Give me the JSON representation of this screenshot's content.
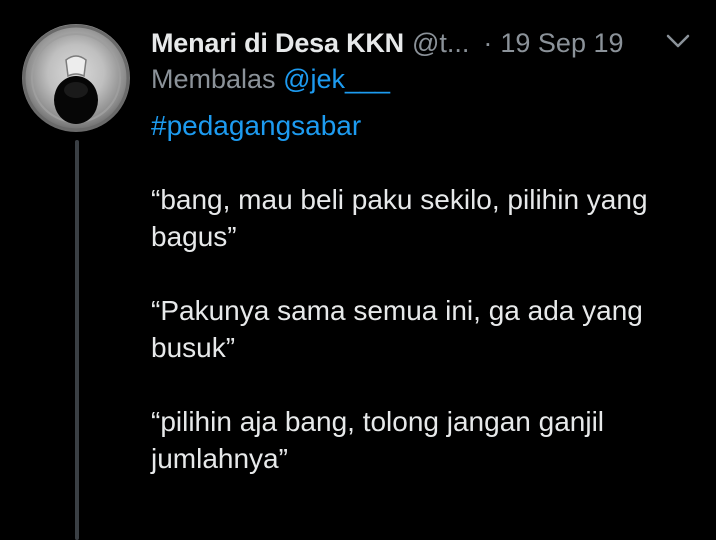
{
  "tweet": {
    "author_name": "Menari di Desa KKN",
    "handle": "@t...",
    "separator": "·",
    "date": "19 Sep 19",
    "reply_prefix": "Membalas",
    "reply_to": "@jek___",
    "hashtag": "#pedagangsabar",
    "paragraphs": [
      "“bang, mau beli paku sekilo, pilihin yang bagus”",
      "“Pakunya sama semua ini, ga ada yang busuk”",
      "“pilihin aja bang, tolong jangan ganjil jumlahnya”"
    ],
    "menu_icon": "chevron-down-icon",
    "colors": {
      "background": "#000000",
      "primary_text": "#e7e9ea",
      "secondary_text": "#8b9299",
      "link": "#1d9bf0",
      "thread_line": "#3a3f44"
    }
  }
}
